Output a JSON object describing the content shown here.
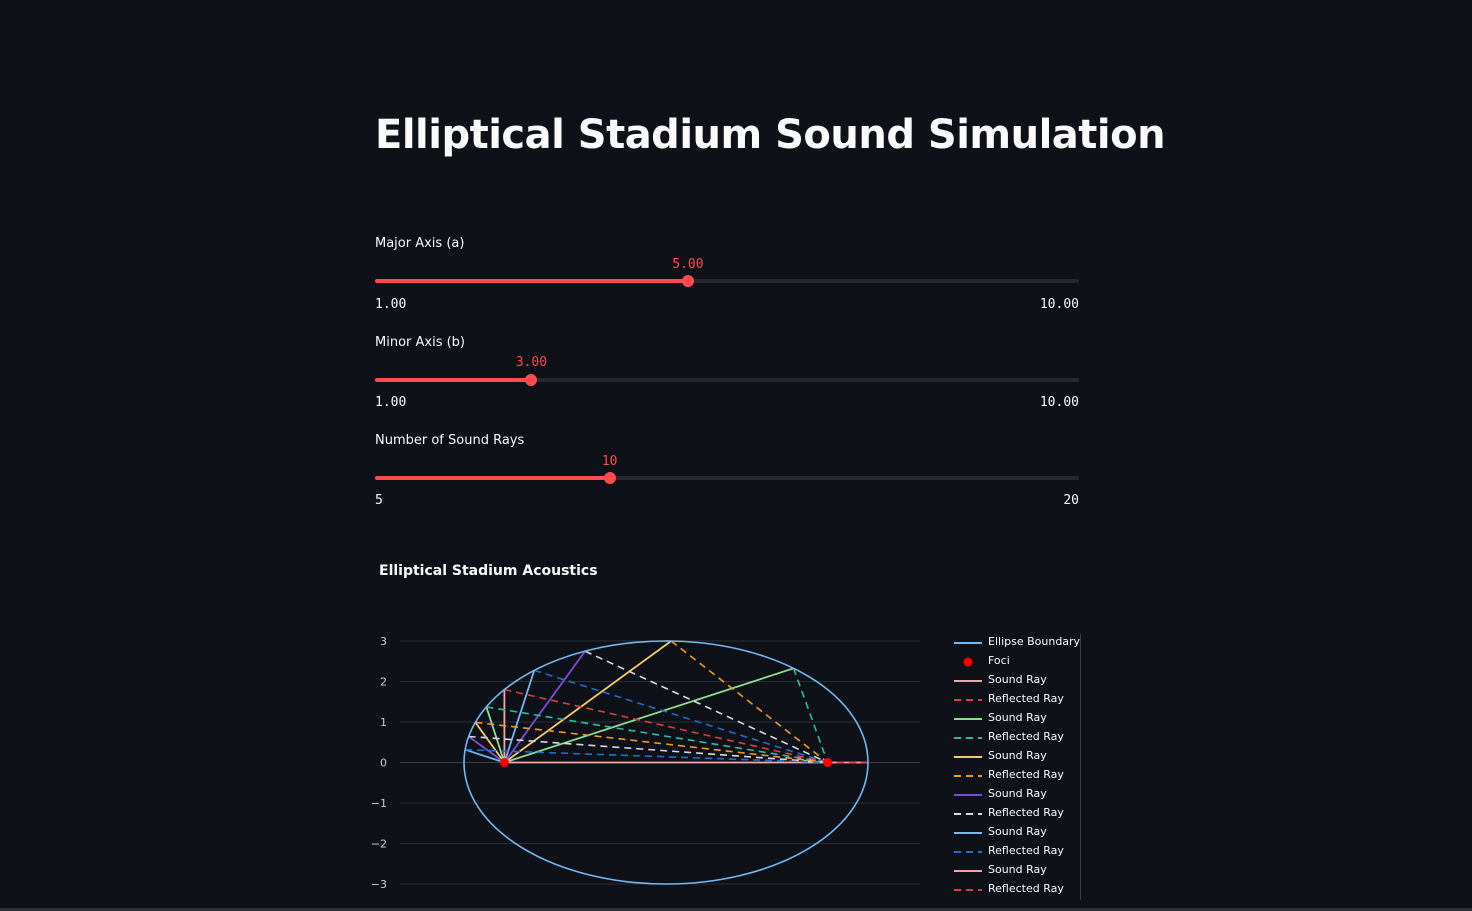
{
  "page": {
    "title": "Elliptical Stadium Sound Simulation"
  },
  "sliders": [
    {
      "id": "major",
      "label": "Major Axis (a)",
      "value_text": "5.00",
      "min_text": "1.00",
      "max_text": "10.00",
      "value": 5,
      "min": 1,
      "max": 10
    },
    {
      "id": "minor",
      "label": "Minor Axis (b)",
      "value_text": "3.00",
      "min_text": "1.00",
      "max_text": "10.00",
      "value": 3,
      "min": 1,
      "max": 10
    },
    {
      "id": "rays",
      "label": "Number of Sound Rays",
      "value_text": "10",
      "min_text": "5",
      "max_text": "20",
      "value": 10,
      "min": 5,
      "max": 20
    }
  ],
  "colors": {
    "background": "#0e1117",
    "accent": "#ff4b4b",
    "track": "#262730",
    "ellipse": "#74b9f2",
    "foci": "#ff0000"
  },
  "chart_data": {
    "type": "line",
    "title": "Elliptical Stadium Acoustics",
    "xlabel": "",
    "ylabel": "",
    "ylim": [
      -3,
      3
    ],
    "yticks": [
      "3",
      "2",
      "1",
      "0",
      "−1",
      "−2",
      "−3"
    ],
    "grid": true,
    "legend_position": "right",
    "ellipse": {
      "a": 5,
      "b": 3,
      "center": [
        0,
        0
      ]
    },
    "foci": [
      [
        -4,
        0
      ],
      [
        4,
        0
      ]
    ],
    "rays": [
      {
        "ray_color": "#f4a7a8",
        "refl_color": "#e63b3b",
        "angle_deg": 0
      },
      {
        "ray_color": "#8ee08e",
        "refl_color": "#2bbfa4",
        "angle_deg": 18
      },
      {
        "ray_color": "#f6c96a",
        "refl_color": "#f39a1e",
        "angle_deg": 36
      },
      {
        "ray_color": "#7e4bd6",
        "refl_color": "#d9d9e3",
        "angle_deg": 54
      },
      {
        "ray_color": "#74b9f2",
        "refl_color": "#1f6fd1",
        "angle_deg": 72
      },
      {
        "ray_color": "#f4a7a8",
        "refl_color": "#e63b3b",
        "angle_deg": 90
      },
      {
        "ray_color": "#8ee08e",
        "refl_color": "#2bbfa4",
        "angle_deg": 108
      },
      {
        "ray_color": "#f6c96a",
        "refl_color": "#f39a1e",
        "angle_deg": 126
      },
      {
        "ray_color": "#7e4bd6",
        "refl_color": "#d9d9e3",
        "angle_deg": 144
      },
      {
        "ray_color": "#74b9f2",
        "refl_color": "#1f6fd1",
        "angle_deg": 162
      }
    ],
    "legend": [
      {
        "label": "Ellipse Boundary",
        "kind": "line",
        "color": "#74b9f2"
      },
      {
        "label": "Foci",
        "kind": "dot",
        "color": "#ff0000"
      },
      {
        "label": "Sound Ray",
        "kind": "line",
        "color": "#f4a7a8"
      },
      {
        "label": "Reflected Ray",
        "kind": "dash",
        "color": "#e63b3b"
      },
      {
        "label": "Sound Ray",
        "kind": "line",
        "color": "#8ee08e"
      },
      {
        "label": "Reflected Ray",
        "kind": "dash",
        "color": "#2bbfa4"
      },
      {
        "label": "Sound Ray",
        "kind": "line",
        "color": "#f6c96a"
      },
      {
        "label": "Reflected Ray",
        "kind": "dash",
        "color": "#f39a1e"
      },
      {
        "label": "Sound Ray",
        "kind": "line",
        "color": "#7e4bd6"
      },
      {
        "label": "Reflected Ray",
        "kind": "dash",
        "color": "#d9d9e3"
      },
      {
        "label": "Sound Ray",
        "kind": "line",
        "color": "#74b9f2"
      },
      {
        "label": "Reflected Ray",
        "kind": "dash",
        "color": "#1f6fd1"
      },
      {
        "label": "Sound Ray",
        "kind": "line",
        "color": "#f4a7a8"
      },
      {
        "label": "Reflected Ray",
        "kind": "dash",
        "color": "#e63b3b"
      }
    ]
  }
}
